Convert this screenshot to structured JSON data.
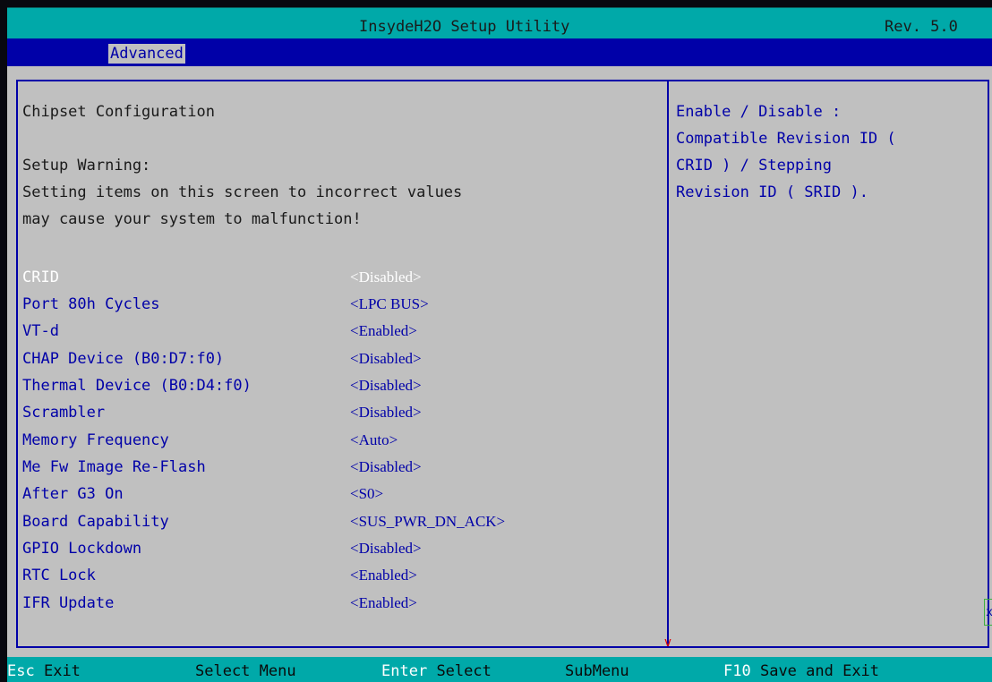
{
  "title": "InsydeH2O Setup Utility",
  "revision": "Rev. 5.0",
  "menu": {
    "active_tab": "Advanced"
  },
  "page": {
    "heading": "Chipset Configuration",
    "warning_title": "Setup Warning:",
    "warning_line1": "Setting items on this screen to incorrect values",
    "warning_line2": "may cause your system to malfunction!"
  },
  "options": [
    {
      "label": "CRID",
      "value": "<Disabled>",
      "selected": true
    },
    {
      "label": "Port 80h Cycles",
      "value": "<LPC BUS>"
    },
    {
      "label": "VT-d",
      "value": "<Enabled>"
    },
    {
      "label": "CHAP Device (B0:D7:f0)",
      "value": "<Disabled>"
    },
    {
      "label": "Thermal Device (B0:D4:f0)",
      "value": "<Disabled>"
    },
    {
      "label": "Scrambler",
      "value": "<Disabled>"
    },
    {
      "label": "Memory Frequency",
      "value": "<Auto>"
    },
    {
      "label": "Me Fw Image Re-Flash",
      "value": "<Disabled>"
    },
    {
      "label": "After G3 On",
      "value": "<S0>"
    },
    {
      "label": "Board Capability",
      "value": "<SUS_PWR_DN_ACK>"
    },
    {
      "label": "GPIO Lockdown",
      "value": "<Disabled>"
    },
    {
      "label": "RTC Lock",
      "value": "<Enabled>"
    },
    {
      "label": "IFR Update",
      "value": "<Enabled>"
    }
  ],
  "help": [
    "Enable / Disable :",
    "Compatible Revision ID (",
    "CRID ) / Stepping",
    "Revision ID ( SRID )."
  ],
  "scroll_indicator": "v",
  "edge_marker": "x",
  "footer": {
    "esc_key": "Esc",
    "esc_label": "Exit",
    "select_menu_label": "Select Menu",
    "enter_key": "Enter",
    "enter_label": "Select",
    "submenu_label": "SubMenu",
    "f10_key": "F10",
    "f10_label": "Save and Exit"
  },
  "colors": {
    "title_bar": "#00a9a9",
    "menu_bar": "#0000a8",
    "panel": "#c0c0c0",
    "option_text": "#0000a8",
    "selected_text": "#ffffff",
    "scroll_indicator": "#e00000"
  }
}
